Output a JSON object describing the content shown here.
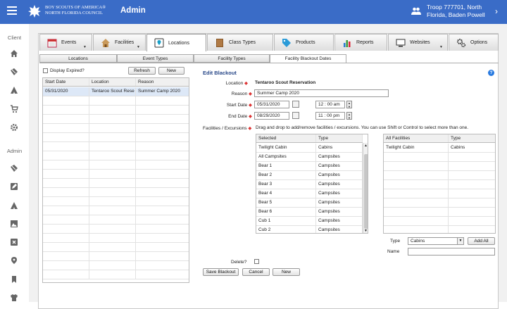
{
  "header": {
    "logo_line1": "BOY SCOUTS OF AMERICA®",
    "logo_line2": "NORTH FLORIDA COUNCIL",
    "app_title": "Admin",
    "troop_line1": "Troop 777701, North",
    "troop_line2": "Florida, Baden Powell",
    "colors": {
      "topbar": "#3a6cc7"
    }
  },
  "sidebar": {
    "client_label": "Client",
    "admin_label": "Admin",
    "client_icons": [
      "home-icon",
      "tickets-icon",
      "campsite-icon",
      "cart-icon",
      "gear-icon"
    ],
    "admin_icons": [
      "tickets-icon",
      "edit-icon",
      "campsite-icon",
      "image-icon",
      "close-box-icon",
      "location-pin-icon",
      "bookmark-icon",
      "shirt-icon"
    ]
  },
  "main_tabs": [
    {
      "label": "Events",
      "icon": "calendar-icon",
      "has_menu": true
    },
    {
      "label": "Facilities",
      "icon": "house-icon",
      "has_menu": true
    },
    {
      "label": "Locations",
      "icon": "map-pin-icon",
      "has_menu": false,
      "active": true
    },
    {
      "label": "Class Types",
      "icon": "book-icon",
      "has_menu": false
    },
    {
      "label": "Products",
      "icon": "tag-icon",
      "has_menu": false
    },
    {
      "label": "Reports",
      "icon": "bar-chart-icon",
      "has_menu": false
    },
    {
      "label": "Websites",
      "icon": "monitor-icon",
      "has_menu": true
    },
    {
      "label": "Options",
      "icon": "gears-icon",
      "has_menu": false
    }
  ],
  "sub_tabs": [
    {
      "label": "Locations"
    },
    {
      "label": "Event Types"
    },
    {
      "label": "Facility Types"
    },
    {
      "label": "Facility Blackout Dates",
      "active": true
    }
  ],
  "list_panel": {
    "display_expired_label": "Display Expired?",
    "refresh_label": "Refresh",
    "new_label": "New",
    "columns": [
      "Start Date",
      "Location",
      "Reason"
    ],
    "rows": [
      [
        "05/31/2020",
        "Tentaroo Scout Rese",
        "Summer Camp 2020"
      ]
    ]
  },
  "edit": {
    "title": "Edit Blackout",
    "location_label": "Location",
    "location_value": "Tentaroo Scout Reservation",
    "reason_label": "Reason",
    "reason_value": "Summer Camp 2020",
    "start_label": "Start Date",
    "start_date": "05/31/2020",
    "start_time": "12 : 00  am",
    "end_label": "End Date",
    "end_date": "08/29/2020",
    "end_time": "11 : 00  pm",
    "facilities_label": "Facilities / Excursions",
    "facilities_hint": "Drag and drop to add/remove facilities / excursions. You can use Shift or Control to select more than one.",
    "selected_columns": [
      "Selected",
      "Type"
    ],
    "selected_rows": [
      [
        "Twilight Cabin",
        "Cabins"
      ],
      [
        "All Campsites",
        "Campsites"
      ],
      [
        "Bear 1",
        "Campsites"
      ],
      [
        "Bear 2",
        "Campsites"
      ],
      [
        "Bear 3",
        "Campsites"
      ],
      [
        "Bear 4",
        "Campsites"
      ],
      [
        "Bear 5",
        "Campsites"
      ],
      [
        "Bear 6",
        "Campsites"
      ],
      [
        "Cub 1",
        "Campsites"
      ],
      [
        "Cub 2",
        "Campsites"
      ]
    ],
    "all_columns": [
      "All Facilities",
      "Type"
    ],
    "all_rows": [
      [
        "Twilight Cabin",
        "Cabins"
      ]
    ],
    "type_label": "Type",
    "type_value": "Cabins",
    "add_all_label": "Add All",
    "name_label": "Name",
    "name_value": "",
    "delete_label": "Delete?",
    "save_label": "Save Blackout",
    "cancel_label": "Cancel",
    "new_label": "New"
  }
}
